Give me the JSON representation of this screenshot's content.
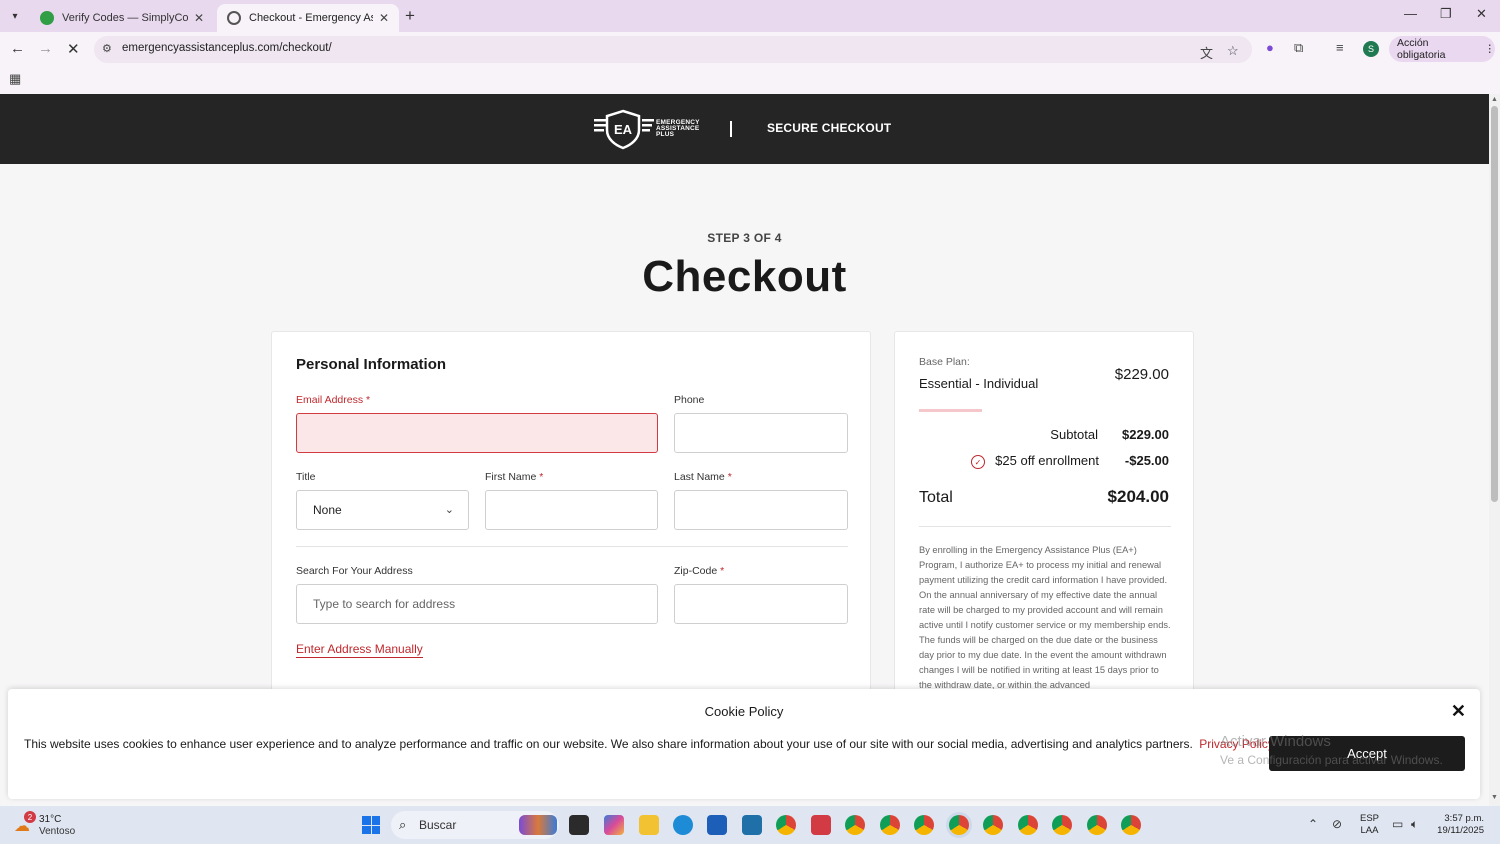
{
  "browser": {
    "tabs": [
      {
        "title": "Verify Codes — SimplyCodes",
        "favicon_color": "#2f9e44"
      },
      {
        "title": "Checkout - Emergency Assistan",
        "favicon_color": "#555555"
      }
    ],
    "url": "emergencyassistanceplus.com/checkout/",
    "action_button": "Acción obligatoria",
    "profile_initial": "S"
  },
  "header": {
    "logo_lines": [
      "EMERGENCY",
      "ASSISTANCE",
      "PLUS"
    ],
    "logo_mark": "EA",
    "secure_checkout": "SECURE CHECKOUT"
  },
  "page": {
    "step": "STEP 3 OF 4",
    "title": "Checkout"
  },
  "personal": {
    "section_title": "Personal Information",
    "email_label": "Email Address",
    "email_value": "",
    "phone_label": "Phone",
    "phone_value": "",
    "title_label": "Title",
    "title_value": "None",
    "first_name_label": "First Name",
    "first_name_value": "",
    "last_name_label": "Last Name",
    "last_name_value": "",
    "address_label": "Search For Your Address",
    "address_placeholder": "Type to search for address",
    "zip_label": "Zip-Code",
    "zip_value": "",
    "manual_link": "Enter Address Manually",
    "required_mark": "*"
  },
  "summary": {
    "plan_label": "Base Plan:",
    "plan_name": "Essential - Individual",
    "plan_price": "$229.00",
    "subtotal_label": "Subtotal",
    "subtotal_value": "$229.00",
    "discount_label": "$25 off enrollment",
    "discount_value": "-$25.00",
    "total_label": "Total",
    "total_value": "$204.00",
    "terms": "By enrolling in the Emergency Assistance Plus (EA+) Program, I authorize EA+ to process my initial and renewal payment utilizing the credit card information I have provided. On the annual anniversary of my effective date the annual rate will be charged to my provided account and will remain active until I notify customer service or my membership ends. The funds will be charged on the due date or the business day prior to my due date. In the event the amount withdrawn changes I will be notified in writing at least 15 days prior to the withdraw date, or within the advanced"
  },
  "cookie": {
    "title": "Cookie Policy",
    "text": "This website uses cookies to enhance user experience and to analyze performance and traffic on our website. We also share information about your use of our site with our social media, advertising and analytics partners.",
    "policy_link": "Privacy Policy",
    "accept": "Accept"
  },
  "watermark": {
    "line1": "Activar Windows",
    "line2": "Ve a Configuración para activar Windows."
  },
  "taskbar": {
    "weather_temp": "31°C",
    "weather_desc": "Ventoso",
    "weather_badge": "2",
    "search_placeholder": "Buscar",
    "lang_line1": "ESP",
    "lang_line2": "LAA",
    "time": "3:57 p.m.",
    "date": "19/11/2025"
  },
  "colors": {
    "accent_red": "#c0282d",
    "header_bg": "#252525",
    "error_bg": "#fce7e8"
  }
}
